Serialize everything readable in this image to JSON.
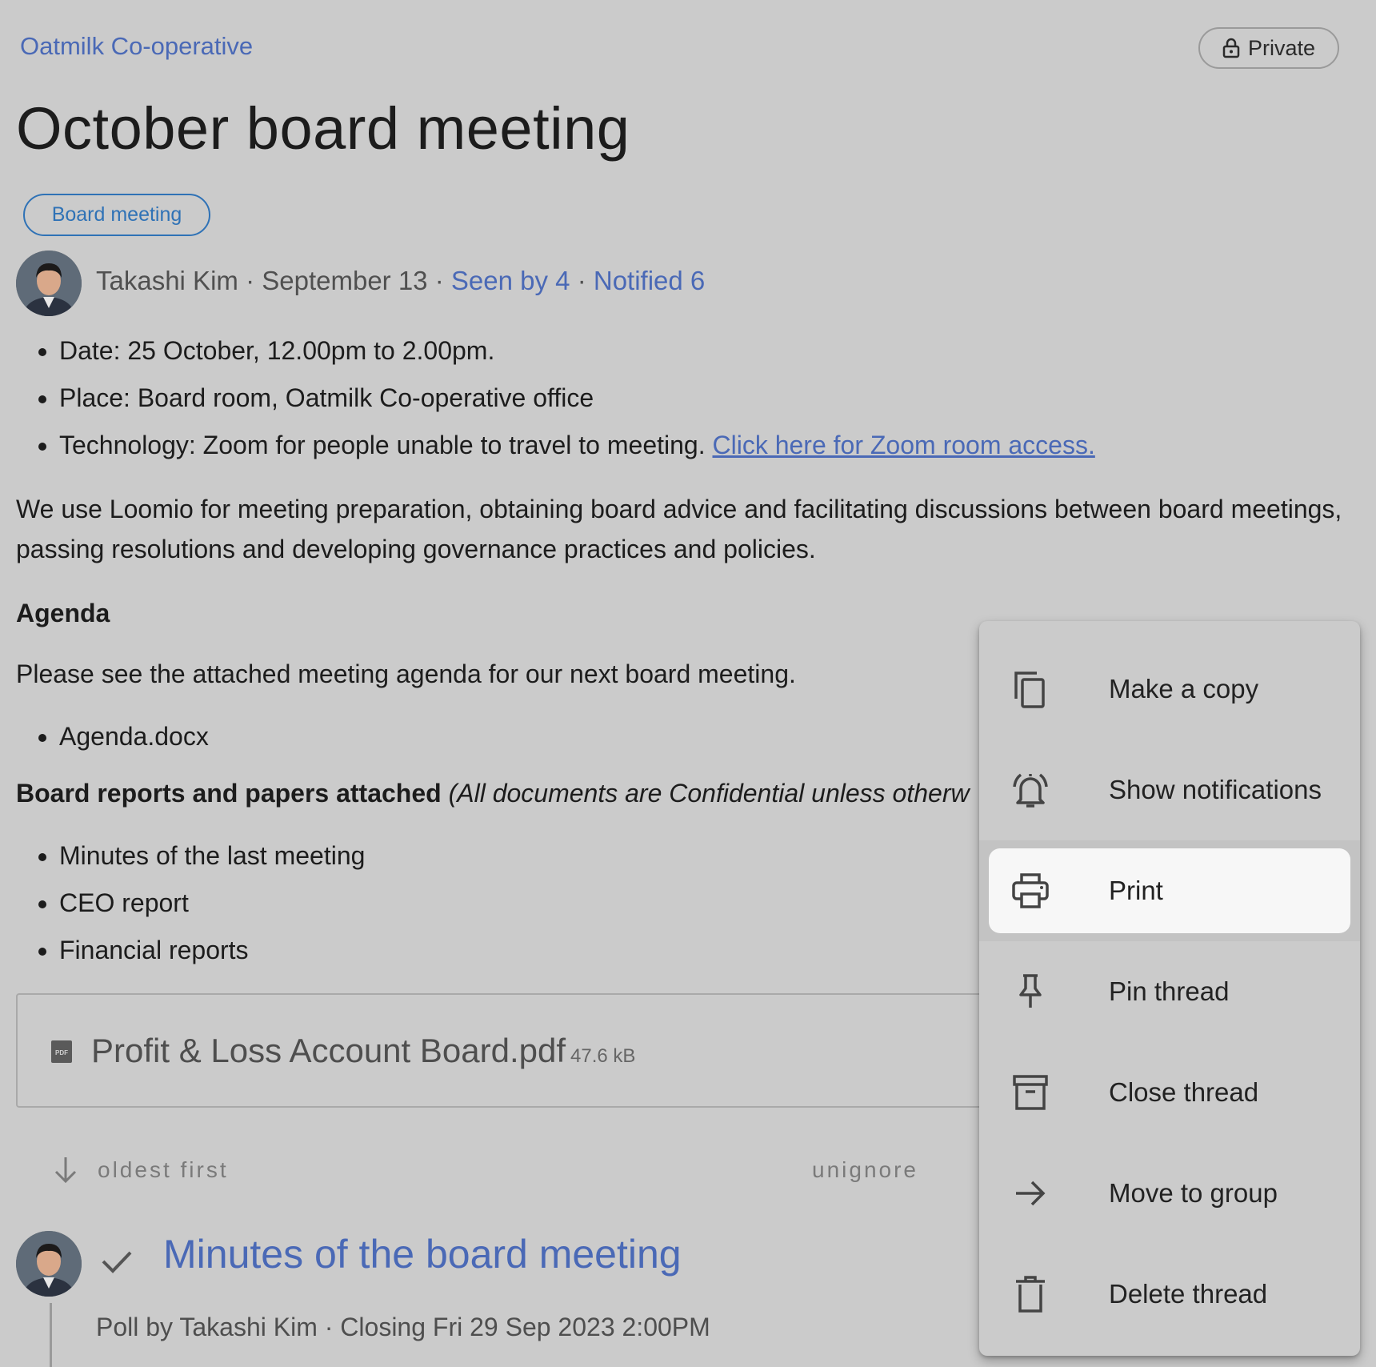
{
  "header": {
    "group_name": "Oatmilk Co-operative",
    "privacy_label": "Private",
    "title": "October board meeting",
    "tag": "Board meeting"
  },
  "author": {
    "name": "Takashi Kim",
    "date": "September 13",
    "seen_by": "Seen by 4",
    "notified": "Notified 6",
    "separator": "·"
  },
  "body": {
    "details": [
      "Date: 25 October, 12.00pm to 2.00pm.",
      "Place: Board room, Oatmilk Co-operative office",
      "Technology: Zoom for people unable to travel to meeting."
    ],
    "zoom_link": "Click here for Zoom room access.",
    "paragraph": "We use Loomio for meeting preparation, obtaining board advice and facilitating discussions between board meetings, passing resolutions and developing governance practices and policies.",
    "agenda_heading": "Agenda",
    "agenda_text": "Please see the attached meeting agenda for our next board meeting.",
    "agenda_items": [
      "Agenda.docx"
    ],
    "reports_heading_bold": "Board reports and papers attached",
    "reports_heading_italic": "(All documents are Confidential unless otherw",
    "reports_items": [
      "Minutes of the last meeting",
      "CEO report",
      "Financial reports"
    ]
  },
  "attachment": {
    "name": "Profit & Loss Account Board.pdf",
    "size": "47.6 kB",
    "icon": "pdf-file-icon"
  },
  "activity": {
    "sort_label": "oldest first",
    "unignore_label": "unignore"
  },
  "poll": {
    "title": "Minutes of the board meeting",
    "meta": "Poll by Takashi Kim · Closing Fri 29 Sep 2023 2:00PM"
  },
  "menu": {
    "items": [
      {
        "label": "Make a copy",
        "icon": "copy-icon"
      },
      {
        "label": "Show notifications",
        "icon": "bell-ring-icon"
      },
      {
        "label": "Print",
        "icon": "printer-icon",
        "highlighted": true
      },
      {
        "label": "Pin thread",
        "icon": "pin-icon"
      },
      {
        "label": "Close thread",
        "icon": "archive-icon"
      },
      {
        "label": "Move to group",
        "icon": "arrow-right-icon"
      },
      {
        "label": "Delete thread",
        "icon": "trash-icon"
      }
    ]
  },
  "colors": {
    "background": "#cbcbcb",
    "link": "#4a69b6",
    "tag": "#2f72b6"
  }
}
